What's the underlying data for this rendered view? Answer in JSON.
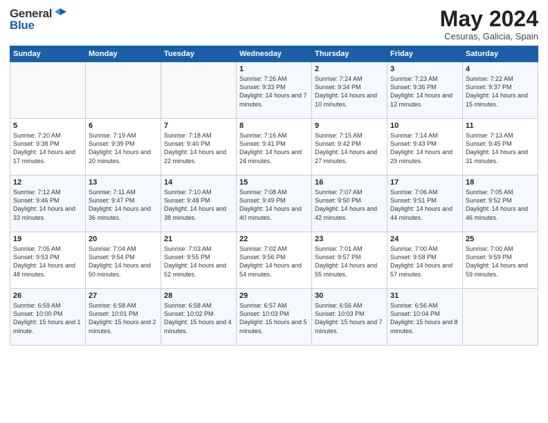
{
  "header": {
    "logo_general": "General",
    "logo_blue": "Blue",
    "month_title": "May 2024",
    "location": "Cesuras, Galicia, Spain"
  },
  "days_of_week": [
    "Sunday",
    "Monday",
    "Tuesday",
    "Wednesday",
    "Thursday",
    "Friday",
    "Saturday"
  ],
  "weeks": [
    [
      {
        "day": "",
        "sunrise": "",
        "sunset": "",
        "daylight": ""
      },
      {
        "day": "",
        "sunrise": "",
        "sunset": "",
        "daylight": ""
      },
      {
        "day": "",
        "sunrise": "",
        "sunset": "",
        "daylight": ""
      },
      {
        "day": "1",
        "sunrise": "Sunrise: 7:26 AM",
        "sunset": "Sunset: 9:33 PM",
        "daylight": "Daylight: 14 hours and 7 minutes."
      },
      {
        "day": "2",
        "sunrise": "Sunrise: 7:24 AM",
        "sunset": "Sunset: 9:34 PM",
        "daylight": "Daylight: 14 hours and 10 minutes."
      },
      {
        "day": "3",
        "sunrise": "Sunrise: 7:23 AM",
        "sunset": "Sunset: 9:36 PM",
        "daylight": "Daylight: 14 hours and 12 minutes."
      },
      {
        "day": "4",
        "sunrise": "Sunrise: 7:22 AM",
        "sunset": "Sunset: 9:37 PM",
        "daylight": "Daylight: 14 hours and 15 minutes."
      }
    ],
    [
      {
        "day": "5",
        "sunrise": "Sunrise: 7:20 AM",
        "sunset": "Sunset: 9:38 PM",
        "daylight": "Daylight: 14 hours and 17 minutes."
      },
      {
        "day": "6",
        "sunrise": "Sunrise: 7:19 AM",
        "sunset": "Sunset: 9:39 PM",
        "daylight": "Daylight: 14 hours and 20 minutes."
      },
      {
        "day": "7",
        "sunrise": "Sunrise: 7:18 AM",
        "sunset": "Sunset: 9:40 PM",
        "daylight": "Daylight: 14 hours and 22 minutes."
      },
      {
        "day": "8",
        "sunrise": "Sunrise: 7:16 AM",
        "sunset": "Sunset: 9:41 PM",
        "daylight": "Daylight: 14 hours and 24 minutes."
      },
      {
        "day": "9",
        "sunrise": "Sunrise: 7:15 AM",
        "sunset": "Sunset: 9:42 PM",
        "daylight": "Daylight: 14 hours and 27 minutes."
      },
      {
        "day": "10",
        "sunrise": "Sunrise: 7:14 AM",
        "sunset": "Sunset: 9:43 PM",
        "daylight": "Daylight: 14 hours and 29 minutes."
      },
      {
        "day": "11",
        "sunrise": "Sunrise: 7:13 AM",
        "sunset": "Sunset: 9:45 PM",
        "daylight": "Daylight: 14 hours and 31 minutes."
      }
    ],
    [
      {
        "day": "12",
        "sunrise": "Sunrise: 7:12 AM",
        "sunset": "Sunset: 9:46 PM",
        "daylight": "Daylight: 14 hours and 33 minutes."
      },
      {
        "day": "13",
        "sunrise": "Sunrise: 7:11 AM",
        "sunset": "Sunset: 9:47 PM",
        "daylight": "Daylight: 14 hours and 36 minutes."
      },
      {
        "day": "14",
        "sunrise": "Sunrise: 7:10 AM",
        "sunset": "Sunset: 9:48 PM",
        "daylight": "Daylight: 14 hours and 38 minutes."
      },
      {
        "day": "15",
        "sunrise": "Sunrise: 7:08 AM",
        "sunset": "Sunset: 9:49 PM",
        "daylight": "Daylight: 14 hours and 40 minutes."
      },
      {
        "day": "16",
        "sunrise": "Sunrise: 7:07 AM",
        "sunset": "Sunset: 9:50 PM",
        "daylight": "Daylight: 14 hours and 42 minutes."
      },
      {
        "day": "17",
        "sunrise": "Sunrise: 7:06 AM",
        "sunset": "Sunset: 9:51 PM",
        "daylight": "Daylight: 14 hours and 44 minutes."
      },
      {
        "day": "18",
        "sunrise": "Sunrise: 7:05 AM",
        "sunset": "Sunset: 9:52 PM",
        "daylight": "Daylight: 14 hours and 46 minutes."
      }
    ],
    [
      {
        "day": "19",
        "sunrise": "Sunrise: 7:05 AM",
        "sunset": "Sunset: 9:53 PM",
        "daylight": "Daylight: 14 hours and 48 minutes."
      },
      {
        "day": "20",
        "sunrise": "Sunrise: 7:04 AM",
        "sunset": "Sunset: 9:54 PM",
        "daylight": "Daylight: 14 hours and 50 minutes."
      },
      {
        "day": "21",
        "sunrise": "Sunrise: 7:03 AM",
        "sunset": "Sunset: 9:55 PM",
        "daylight": "Daylight: 14 hours and 52 minutes."
      },
      {
        "day": "22",
        "sunrise": "Sunrise: 7:02 AM",
        "sunset": "Sunset: 9:56 PM",
        "daylight": "Daylight: 14 hours and 54 minutes."
      },
      {
        "day": "23",
        "sunrise": "Sunrise: 7:01 AM",
        "sunset": "Sunset: 9:57 PM",
        "daylight": "Daylight: 14 hours and 55 minutes."
      },
      {
        "day": "24",
        "sunrise": "Sunrise: 7:00 AM",
        "sunset": "Sunset: 9:58 PM",
        "daylight": "Daylight: 14 hours and 57 minutes."
      },
      {
        "day": "25",
        "sunrise": "Sunrise: 7:00 AM",
        "sunset": "Sunset: 9:59 PM",
        "daylight": "Daylight: 14 hours and 59 minutes."
      }
    ],
    [
      {
        "day": "26",
        "sunrise": "Sunrise: 6:59 AM",
        "sunset": "Sunset: 10:00 PM",
        "daylight": "Daylight: 15 hours and 1 minute."
      },
      {
        "day": "27",
        "sunrise": "Sunrise: 6:58 AM",
        "sunset": "Sunset: 10:01 PM",
        "daylight": "Daylight: 15 hours and 2 minutes."
      },
      {
        "day": "28",
        "sunrise": "Sunrise: 6:58 AM",
        "sunset": "Sunset: 10:02 PM",
        "daylight": "Daylight: 15 hours and 4 minutes."
      },
      {
        "day": "29",
        "sunrise": "Sunrise: 6:57 AM",
        "sunset": "Sunset: 10:03 PM",
        "daylight": "Daylight: 15 hours and 5 minutes."
      },
      {
        "day": "30",
        "sunrise": "Sunrise: 6:56 AM",
        "sunset": "Sunset: 10:03 PM",
        "daylight": "Daylight: 15 hours and 7 minutes."
      },
      {
        "day": "31",
        "sunrise": "Sunrise: 6:56 AM",
        "sunset": "Sunset: 10:04 PM",
        "daylight": "Daylight: 15 hours and 8 minutes."
      },
      {
        "day": "",
        "sunrise": "",
        "sunset": "",
        "daylight": ""
      }
    ]
  ]
}
